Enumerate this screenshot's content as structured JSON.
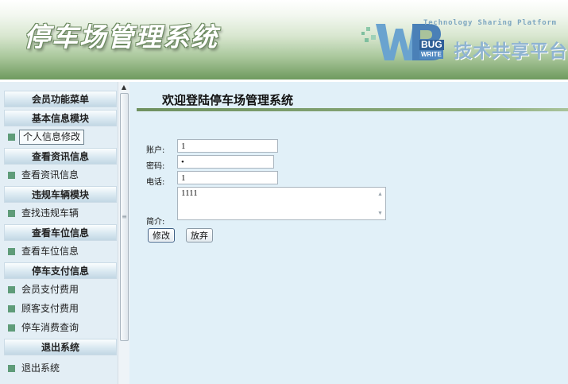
{
  "header": {
    "title": "停车场管理系统",
    "logo": {
      "tagline": "Technology Sharing Platform",
      "bug": "BUG",
      "write": "WRITE",
      "chinese": "技术共享平台"
    }
  },
  "sidebar": {
    "menu_title": "会员功能菜单",
    "sections": [
      {
        "title": "基本信息模块",
        "items": [
          "个人信息修改"
        ]
      },
      {
        "title": "查看资讯信息",
        "items": [
          "查看资讯信息"
        ]
      },
      {
        "title": "违规车辆模块",
        "items": [
          "查找违规车辆"
        ]
      },
      {
        "title": "查看车位信息",
        "items": [
          "查看车位信息"
        ]
      },
      {
        "title": "停车支付信息",
        "items": [
          "会员支付费用",
          "顾客支付费用",
          "停车消费查询"
        ]
      },
      {
        "title": "退出系统",
        "items": [
          "退出系统"
        ]
      }
    ]
  },
  "main": {
    "page_title": "欢迎登陆停车场管理系统",
    "form": {
      "account_label": "账户:",
      "account_value": "1",
      "password_label": "密码:",
      "password_value": "•",
      "phone_label": "电话:",
      "phone_value": "1",
      "intro_label": "简介:",
      "intro_value": "1111"
    },
    "buttons": {
      "modify": "修改",
      "discard": "放弃"
    }
  },
  "colors": {
    "header_gradient_end": "#6f9a5e",
    "sidebar_bg": "#e3eef5",
    "content_bg": "#e1f0f8",
    "bullet": "#5f9c79",
    "title_underline": "#8cab7c"
  }
}
